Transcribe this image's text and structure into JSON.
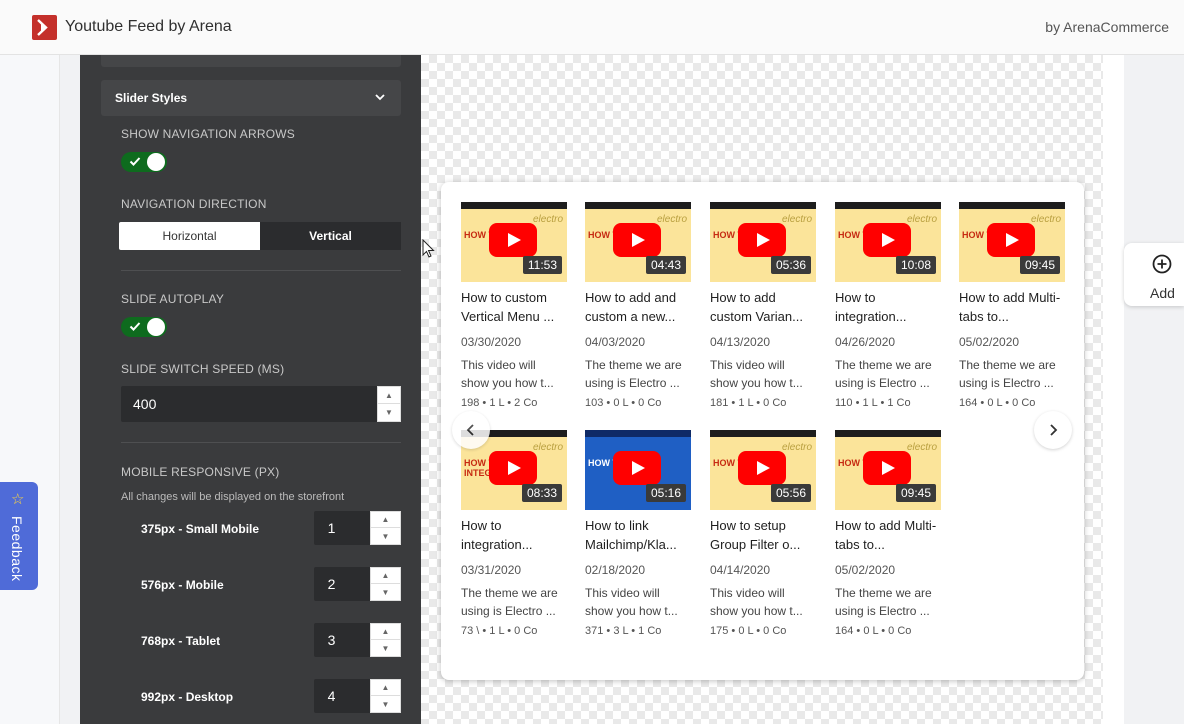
{
  "app": {
    "title": "Youtube Feed by Arena",
    "author": "by ArenaCommerce"
  },
  "panel": {
    "section_title": "Slider Styles",
    "show_arrows_label": "SHOW NAVIGATION ARROWS",
    "show_arrows_on": true,
    "nav_direction_label": "NAVIGATION DIRECTION",
    "nav_direction_options": [
      "Horizontal",
      "Vertical"
    ],
    "nav_direction_selected": "Vertical",
    "autoplay_label": "SLIDE AUTOPLAY",
    "autoplay_on": true,
    "speed_label": "SLIDE SWITCH SPEED (MS)",
    "speed_value": "400",
    "mobile_label": "MOBILE RESPONSIVE (PX)",
    "mobile_note": "All changes will be displayed on the storefront",
    "breakpoints": [
      {
        "label": "375px - Small Mobile",
        "value": "1"
      },
      {
        "label": "576px - Mobile",
        "value": "2"
      },
      {
        "label": "768px - Tablet",
        "value": "3"
      },
      {
        "label": "992px - Desktop",
        "value": "4"
      }
    ]
  },
  "videos": [
    {
      "title": "How to custom Vertical Menu ...",
      "date": "03/30/2020",
      "desc": "This video will show you how t...",
      "stats": "198  •  1 L  •  2 Co",
      "duration": "11:53",
      "thumb_text": "HOW TO ADD",
      "brand": "electro",
      "thumb_style": "yellow"
    },
    {
      "title": "How to add and custom a new...",
      "date": "04/03/2020",
      "desc": "The theme we are using is Electro ...",
      "stats": "103  •  0 L  •  0 Co",
      "duration": "04:43",
      "thumb_text": "HOW TO ADD",
      "brand": "electro",
      "thumb_style": "yellow"
    },
    {
      "title": "How to add custom Varian...",
      "date": "04/13/2020",
      "desc": "This video will show you how t...",
      "stats": "181  •  1 L  •  0 Co",
      "duration": "05:36",
      "thumb_text": "HOW TO ADD",
      "brand": "electro",
      "thumb_style": "yellow"
    },
    {
      "title": "How to integration...",
      "date": "04/26/2020",
      "desc": "The theme we are using is Electro ...",
      "stats": "110  •  1 L  •  1 Co",
      "duration": "10:08",
      "thumb_text": "HOW TO IN",
      "brand": "electro",
      "thumb_style": "yellow"
    },
    {
      "title": "How to add Multi-tabs to...",
      "date": "05/02/2020",
      "desc": "The theme we are using is Electro ...",
      "stats": "164  •  0 L  •  0 Co",
      "duration": "09:45",
      "thumb_text": "HOW TO ADD",
      "brand": "electro",
      "thumb_style": "yellow"
    },
    {
      "title": "How to integration...",
      "date": "03/31/2020",
      "desc": "The theme we are using is Electro ...",
      "stats": "73 \\  •  1 L  •  0 Co",
      "duration": "08:33",
      "thumb_text": "HOW TO INTEGRATION",
      "brand": "electro",
      "thumb_style": "yellow"
    },
    {
      "title": "How to link Mailchimp/Kla...",
      "date": "02/18/2020",
      "desc": "This video will show you how t...",
      "stats": "371  •  3 L  •  1 Co",
      "duration": "05:16",
      "thumb_text": "HOW TO",
      "brand": "",
      "thumb_style": "blue"
    },
    {
      "title": "How to setup Group Filter o...",
      "date": "04/14/2020",
      "desc": "This video will show you how t...",
      "stats": "175  •  0 L  •  0 Co",
      "duration": "05:56",
      "thumb_text": "HOW TO SETUP",
      "brand": "electro",
      "thumb_style": "yellow"
    },
    {
      "title": "How to add Multi-tabs to...",
      "date": "05/02/2020",
      "desc": "The theme we are using is Electro ...",
      "stats": "164  •  0 L  •  0 Co",
      "duration": "09:45",
      "thumb_text": "HOW TO ADD",
      "brand": "electro",
      "thumb_style": "yellow"
    }
  ],
  "add_button": {
    "label": "Add"
  },
  "feedback": {
    "label": "Feedback"
  }
}
